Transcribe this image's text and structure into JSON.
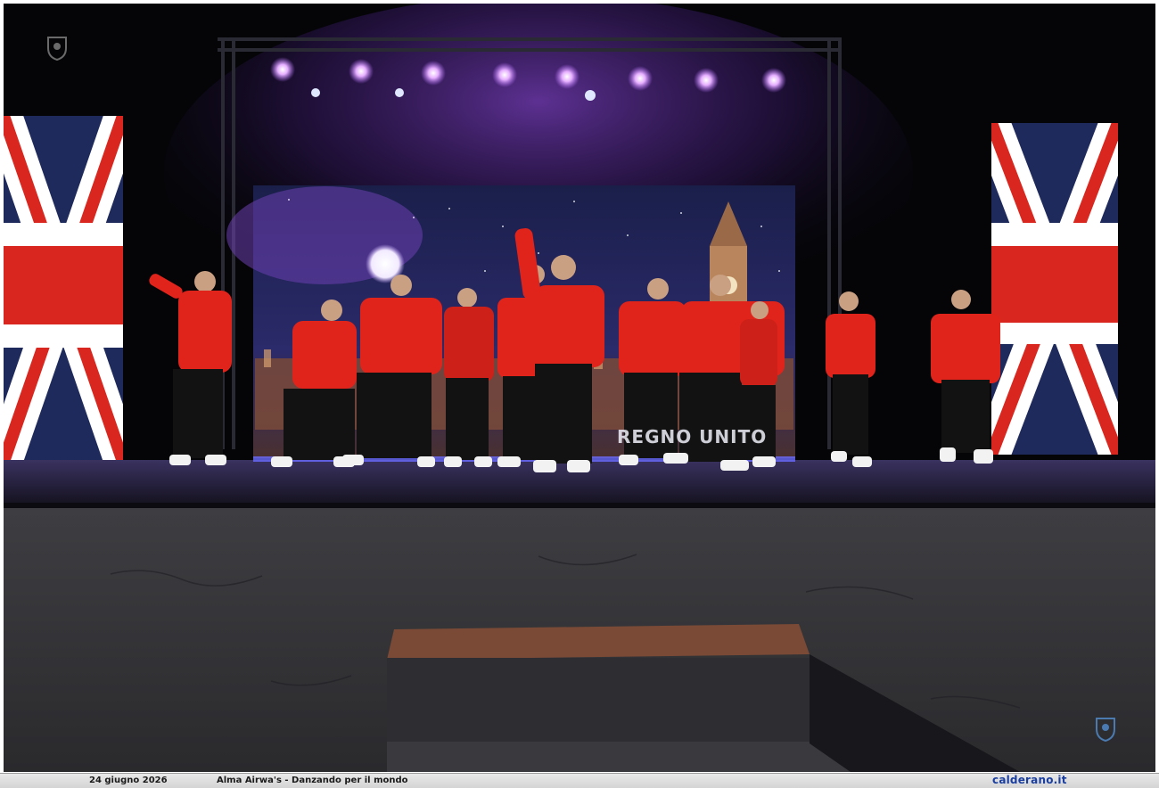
{
  "photo": {
    "description_icon": "stage-photo",
    "screen_text": "REGNO UNITO",
    "colors": {
      "stage_light": "#b36bff",
      "hoodie": "#e0241c",
      "flag_blue": "#1f2a5c",
      "flag_red": "#d9261e"
    }
  },
  "caption": {
    "date": "24 giugno 2026",
    "title": "Alma Airwa's - Danzando per il mondo",
    "site": "calderano.it"
  },
  "icons": {
    "top_left": "crest-icon",
    "bottom_right": "crest-icon"
  }
}
